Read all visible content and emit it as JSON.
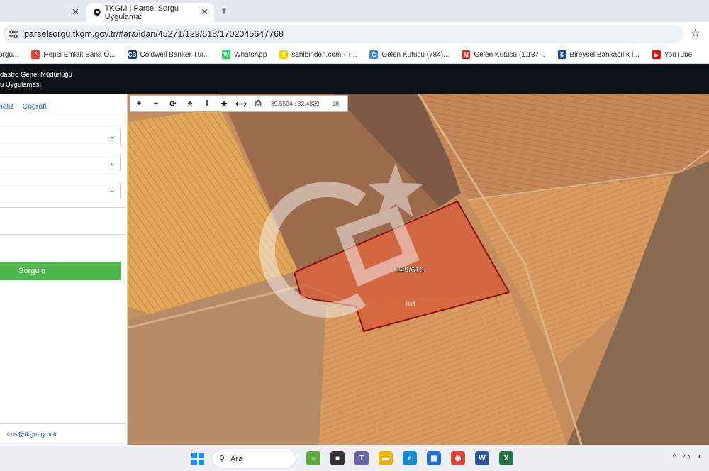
{
  "browser": {
    "tabs": [
      {
        "label": "",
        "active": false
      },
      {
        "label": "TKGM | Parsel Sorgu Uygulama:",
        "active": true
      }
    ],
    "url": "parselsorgu.tkgm.gov.tr/#ara/idari/45271/129/618/1702045647768",
    "bookmarks": [
      {
        "label": "orgu...",
        "icon": "generic-icon",
        "color": "#2b7bd6",
        "glyph": ""
      },
      {
        "label": "Hepsi Emlak Bana Ö...",
        "icon": "hepsiemlak-icon",
        "color": "#e8412c",
        "glyph": "^"
      },
      {
        "label": "Coldwell Banker Tür...",
        "icon": "coldwell-banker-icon",
        "color": "#123a7a",
        "glyph": "CB"
      },
      {
        "label": "WhatsApp",
        "icon": "whatsapp-icon",
        "color": "#25d366",
        "glyph": "W"
      },
      {
        "label": "sahibinden.com - T...",
        "icon": "sahibinden-icon",
        "color": "#f5d000",
        "glyph": "S"
      },
      {
        "label": "Gelen Kutusu (784)...",
        "icon": "google-icon",
        "color": "#4285f4",
        "glyph": "G"
      },
      {
        "label": "Gelen Kutusu (1.137...",
        "icon": "gmail-icon",
        "color": "#d93025",
        "glyph": "M"
      },
      {
        "label": "Bireysel Bankacılık İ...",
        "icon": "bank-icon",
        "color": "#1f4f9a",
        "glyph": "$"
      },
      {
        "label": "YouTube",
        "icon": "youtube-icon",
        "color": "#ff0000",
        "glyph": "▶"
      }
    ]
  },
  "app": {
    "header_line1": "dastro Genel Müdürlüğü",
    "header_line2": "u Uygulaması"
  },
  "sidebar": {
    "tabs": [
      "naliz",
      "Coğrafi"
    ],
    "selects": [
      "",
      "",
      ""
    ],
    "submit_label": "Sorgula",
    "email": "cbs@tkgm.gov.tr"
  },
  "map": {
    "toolbar_icons": [
      "+",
      "−",
      "⟳",
      "⌖",
      "i",
      "★",
      "⟷",
      "⎙"
    ],
    "coordinates": "39.5594 : 32.4829",
    "zoom": "18",
    "parcel_label": "129/618",
    "watermark_mark": "BM",
    "parcel_fill": "#d85a3a",
    "parcel_stroke": "#8b1010"
  },
  "taskbar": {
    "search_label": "Ara",
    "icons": [
      {
        "name": "widgets-icon",
        "color": "#5fa83a",
        "glyph": "☼"
      },
      {
        "name": "file-explorer-icon",
        "color": "#333",
        "glyph": "■"
      },
      {
        "name": "teams-icon",
        "color": "#6264a7",
        "glyph": "T"
      },
      {
        "name": "folder-icon",
        "color": "#f0b400",
        "glyph": "▬"
      },
      {
        "name": "edge-icon",
        "color": "#0f8bd8",
        "glyph": "e"
      },
      {
        "name": "store-icon",
        "color": "#1d6fd1",
        "glyph": "▦"
      },
      {
        "name": "chrome-icon",
        "color": "#db4437",
        "glyph": "◉"
      },
      {
        "name": "word-icon",
        "color": "#2b579a",
        "glyph": "W"
      },
      {
        "name": "excel-icon",
        "color": "#217346",
        "glyph": "X"
      }
    ]
  }
}
